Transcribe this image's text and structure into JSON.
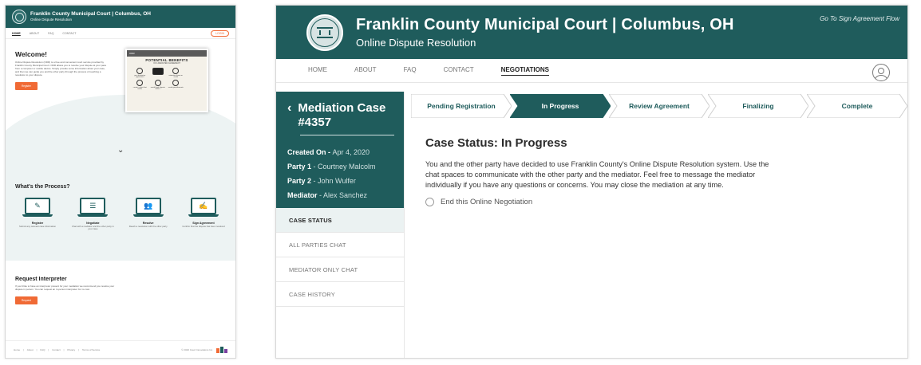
{
  "left": {
    "header": {
      "title": "Franklin County Municipal Court | Columbus, OH",
      "subtitle": "Online Dispute Resolution"
    },
    "nav": {
      "items": [
        "HOME",
        "ABOUT",
        "FAQ",
        "CONTACT"
      ],
      "login": "LOGIN"
    },
    "welcome": {
      "title": "Welcome!",
      "text": "Online Dispute Resolution (ODR) is a free and convenient court service provided by Franklin County Municipal Court. ODR allows you to resolve your dispute at your pace from a computer or mobile device. Simply provide some information about your case, and then we can guide you and the other party through the process of reaching a resolution to your dispute.",
      "button": "Register"
    },
    "video": {
      "bar": "ODR",
      "heading": "POTENTIAL BENEFITS",
      "subheading": "OF A MEDIATED AGREEMENT",
      "items": [
        "you determine agreement",
        "",
        "minimize harm on credit",
        "",
        "create a plan that works",
        "avoid legal dispute tactics",
        "avoid garnishments",
        ""
      ]
    },
    "process": {
      "title": "What's the Process?",
      "steps": [
        {
          "title": "Register",
          "desc": "Submit any relevant case information",
          "icon": "✎"
        },
        {
          "title": "Negotiate",
          "desc": "Chat with a mediator and the other party in your case",
          "icon": "☰"
        },
        {
          "title": "Resolve",
          "desc": "Reach a resolution with the other party",
          "icon": "👥"
        },
        {
          "title": "Sign Agreement",
          "desc": "Confirm that the dispute has been resolved",
          "icon": "✍"
        }
      ]
    },
    "interpreter": {
      "title": "Request Interpreter",
      "text": "If you'd like to have an interpreter present for your mediation we recommend you resolve your dispute in person. You can request an in-person interpreter for no cost.",
      "button": "Request"
    },
    "footer": {
      "links": [
        "Home",
        "|",
        "About",
        "|",
        "FAQ",
        "|",
        "Contact",
        "|",
        "Privacy",
        "|",
        "Terms of Service"
      ],
      "copyright": "© 2020 Court Innovations Inc."
    }
  },
  "right": {
    "header": {
      "title": "Franklin County Municipal Court | Columbus, OH",
      "subtitle": "Online Dispute Resolution",
      "flow_link": "Go To Sign Agreement Flow"
    },
    "nav": {
      "items": [
        "HOME",
        "ABOUT",
        "FAQ",
        "CONTACT",
        "NEGOTIATIONS"
      ],
      "active": "NEGOTIATIONS"
    },
    "case": {
      "title": "Mediation Case #4357",
      "created_label": "Created On - ",
      "created_value": "Apr 4, 2020",
      "party1_label": "Party 1",
      "party1_value": " - Courtney Malcolm",
      "party2_label": "Party 2",
      "party2_value": " - John Wulfer",
      "mediator_label": "Mediator",
      "mediator_value": " - Alex Sanchez"
    },
    "tabs": [
      "CASE STATUS",
      "ALL PARTIES CHAT",
      "MEDIATOR ONLY CHAT",
      "CASE HISTORY"
    ],
    "steps": [
      "Pending Registration",
      "In Progress",
      "Review Agreement",
      "Finalizing",
      "Complete"
    ],
    "active_step": 1,
    "status": {
      "title": "Case Status: In Progress",
      "text": "You and the other party have decided to use Franklin County's Online Dispute Resolution system. Use the chat spaces to communicate with the other party and the mediator. Feel free to message the mediator individually if you have any questions or concerns. You may close the mediation at any time.",
      "option": "End this Online Negotiation"
    }
  },
  "colors": {
    "primary": "#1f5c5c",
    "accent": "#f06a35",
    "light": "#edf3f3"
  }
}
